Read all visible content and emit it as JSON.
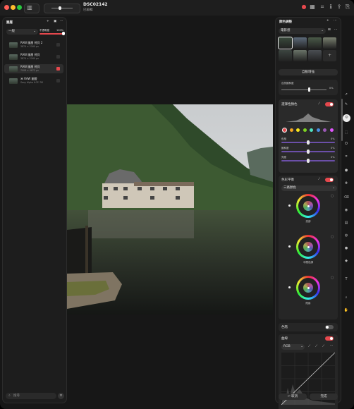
{
  "window": {
    "title": "DSC02142",
    "subtitle": "已編輯"
  },
  "left_panel": {
    "title": "圖層",
    "blend_mode": "一般",
    "opacity_label": "不透明度",
    "opacity_value": "100%",
    "opacity_level": 1.0,
    "layers": [
      {
        "name": "RAW 圖層 拷貝 2",
        "size": "3874 × 2160 px",
        "selected": false
      },
      {
        "name": "RAW 圖層 拷貝",
        "size": "3874 × 2160 px",
        "selected": false
      },
      {
        "name": "RAW 圖層 拷貝",
        "size": "7008 × 4672 px",
        "selected": true
      },
      {
        "name": "⌘ RAW 圖層",
        "size": "Sony Alpha ILCE-7M",
        "selected": false
      }
    ],
    "search_placeholder": "搜尋"
  },
  "right_panel": {
    "title": "顏色調整",
    "preset_label": "電影感",
    "auto_enhance_label": "自動增強",
    "lut_label": "自然飽和度",
    "lut_value": "0%",
    "color_section": {
      "title": "選擇性顏色",
      "colors": [
        "#e5484d",
        "#f5a623",
        "#f8e71c",
        "#7ed321",
        "#50e3c2",
        "#4a90e2",
        "#9b59b6",
        "#e056fd"
      ],
      "rows": [
        {
          "label": "色相",
          "value": "0%"
        },
        {
          "label": "飽和度",
          "value": "0%"
        },
        {
          "label": "亮度",
          "value": "0%"
        }
      ]
    },
    "balance_section": {
      "title": "色彩平衡",
      "mode": "三路顏色",
      "wheels": [
        "亮部",
        "中間色調",
        "陰影"
      ]
    },
    "curves_section": {
      "title": "曲線",
      "channel": "RGB",
      "cancel_label": "取消",
      "apply_label": "完成"
    },
    "levels_label": "色階"
  }
}
